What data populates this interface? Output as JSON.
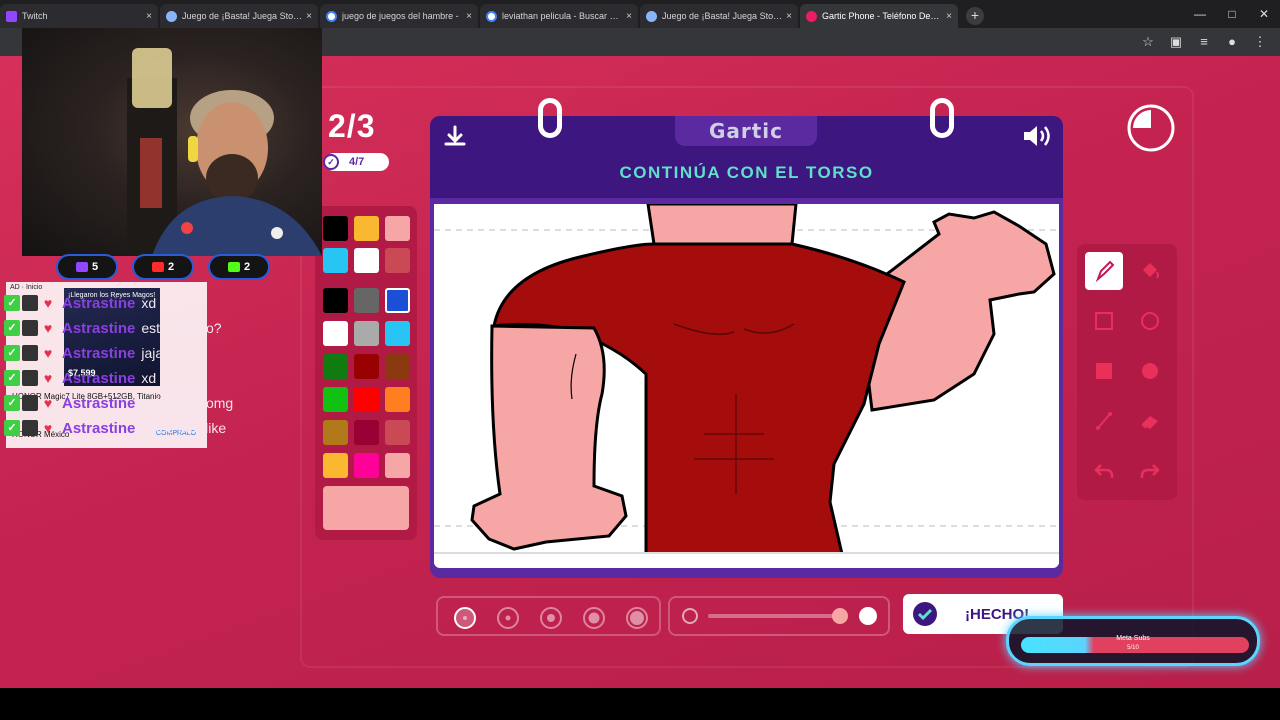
{
  "browser": {
    "tabs": [
      {
        "label": "Twitch",
        "favicon": "twitch-icon",
        "active": false
      },
      {
        "label": "Juego de ¡Basta! Juega Stop, Tu",
        "favicon": "globe-icon",
        "active": false
      },
      {
        "label": "juego de juegos del hambre -",
        "favicon": "google-icon",
        "active": false
      },
      {
        "label": "leviathan pelicula - Buscar con",
        "favicon": "google-icon",
        "active": false
      },
      {
        "label": "Juego de ¡Basta! Juega Stop, Tu",
        "favicon": "globe-icon",
        "active": false
      },
      {
        "label": "Gartic Phone - Teléfono Desco",
        "favicon": "phone-icon",
        "active": true
      }
    ],
    "new_tab": "+",
    "tab_close": "×"
  },
  "game": {
    "round": "2/3",
    "players_done": "4/7",
    "logo": "Gartic",
    "instruction": "CONTINÚA CON EL TORSO",
    "done_button": "¡HECHO!",
    "palette": [
      "#000000",
      "#f9b82f",
      "#f7a6a6",
      "#27c4f4",
      "#ffffff",
      "#c94a55",
      "#000000",
      "#666666",
      "#1a4fd6",
      "#ffffff",
      "#aaaaaa",
      "#27c4f4",
      "#107c10",
      "#990000",
      "#8b3a0f",
      "#11c011",
      "#ff0000",
      "#ff7e1f",
      "#b07a1a",
      "#990033",
      "#c94a55",
      "#f9b82f",
      "#ff0098",
      "#f7a6a6"
    ],
    "selected_swatch": 8,
    "current_color": "#f7a6a6",
    "tools": [
      "pen-icon",
      "bucket-icon",
      "square-outline-icon",
      "circle-outline-icon",
      "square-filled-icon",
      "circle-filled-icon",
      "line-icon",
      "eraser-icon",
      "undo-icon",
      "redo-icon"
    ],
    "selected_tool": 0,
    "brush_size_selected": 0,
    "opacity_level": 0.9
  },
  "overlay": {
    "stats": [
      {
        "icon": "twitch-icon",
        "value": "5",
        "color": "#9146ff"
      },
      {
        "icon": "youtube-icon",
        "value": "2",
        "color": "#ff2a2a"
      },
      {
        "icon": "kick-icon",
        "value": "2",
        "color": "#53fc18"
      }
    ],
    "chat": [
      {
        "user": "Astrastine",
        "msg": "xd"
      },
      {
        "user": "Astrastine",
        "msg": "esta mocho?"
      },
      {
        "user": "Astrastine",
        "msg": "jaja"
      },
      {
        "user": "Astrastine",
        "msg": "xd"
      },
      {
        "user": "Astrastine",
        "msg": "cabezudo omg"
      },
      {
        "user": "Astrastine",
        "msg": "chico bee like"
      }
    ],
    "ad": {
      "label": "AD · Inicio",
      "headline": "¡Llegaron los Reyes Magos!",
      "price": "$7,599",
      "product": "HONOR Magic7 Lite 8GB+512GB, Titanio",
      "seller": "HONOR México",
      "cta": "COMPRALO"
    },
    "meta_subs": {
      "label": "Meta Subs",
      "count": "5/10",
      "progress": 0.5
    }
  }
}
